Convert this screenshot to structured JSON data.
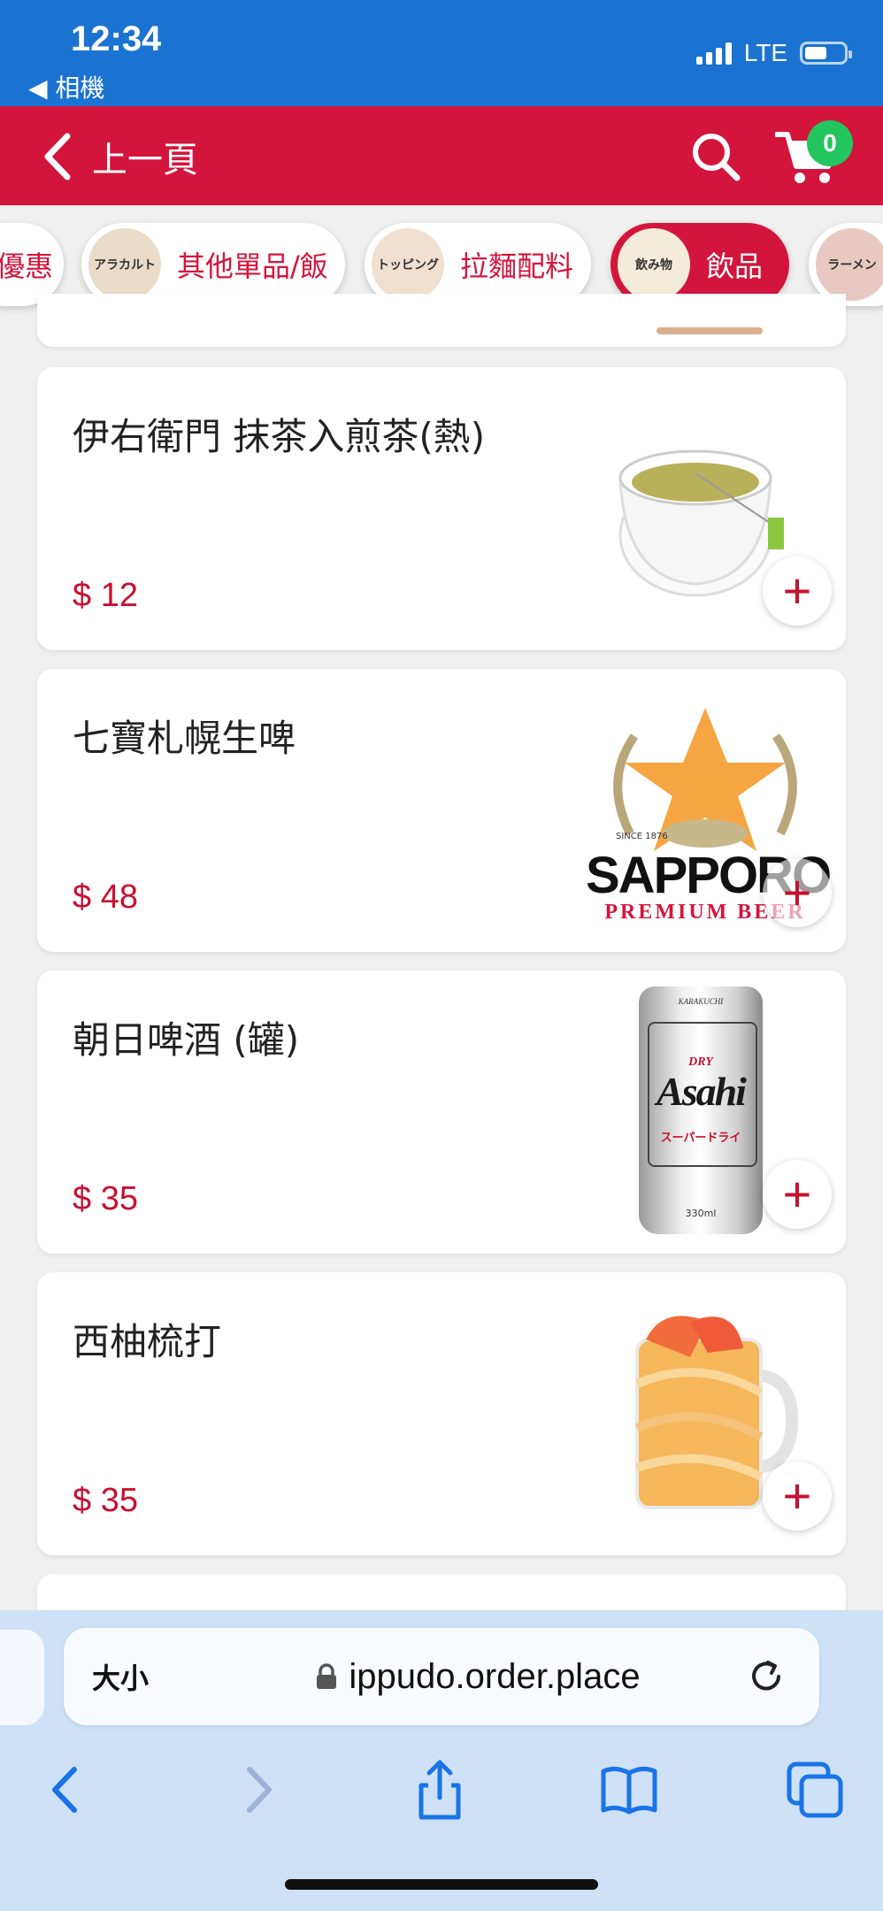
{
  "status_bar": {
    "time": "12:34",
    "back_app": "◀ 相機",
    "network": "LTE"
  },
  "header": {
    "back_label": "上一頁",
    "cart_count": "0"
  },
  "categories": [
    {
      "label": "優惠",
      "thumb": ""
    },
    {
      "label": "其他單品/飯",
      "thumb": "アラカルト"
    },
    {
      "label": "拉麵配料",
      "thumb": "トッピング"
    },
    {
      "label": "飲品",
      "thumb": "飲み物",
      "active": true
    },
    {
      "label": "",
      "thumb": "ラーメン"
    }
  ],
  "products": [
    {
      "name": "伊右衛門 抹茶入煎茶(熱)",
      "price": "$ 12",
      "image": "green-tea-cup"
    },
    {
      "name": "七寶札幌生啤",
      "price": "$ 48",
      "image": "sapporo-logo",
      "brand": "SAPPORO",
      "brand_sub": "PREMIUM BEER",
      "since": "SINCE 1876"
    },
    {
      "name": "朝日啤酒 (罐)",
      "price": "$ 35",
      "image": "asahi-can",
      "brand": "Asahi",
      "can_text": "スーパードライ",
      "can_size": "330ml",
      "can_top": "KARAKUCHI",
      "can_dry": "DRY"
    },
    {
      "name": "西柚梳打",
      "price": "$ 35",
      "image": "grapefruit-soda"
    }
  ],
  "browser": {
    "text_size": "大小",
    "domain": "ippudo.order.place"
  },
  "colors": {
    "brand_red": "#d4153b",
    "status_blue": "#1a73d1",
    "badge_green": "#22c55e",
    "price_red": "#c8102e"
  }
}
